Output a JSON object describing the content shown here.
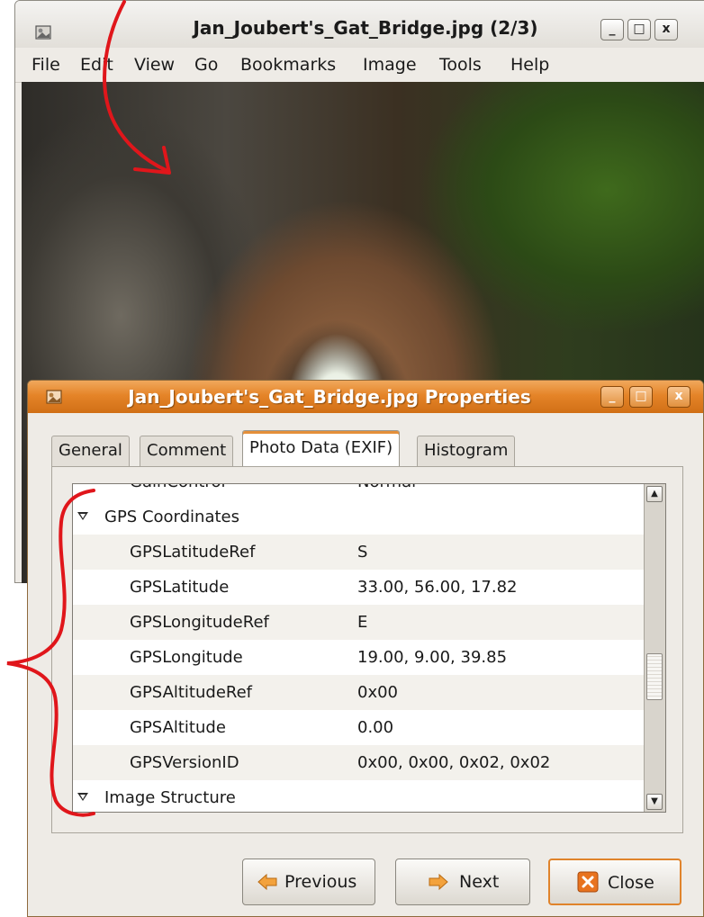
{
  "viewer": {
    "title": "Jan_Joubert's_Gat_Bridge.jpg  (2/3)",
    "window_buttons": {
      "minimize": "_",
      "maximize": "□",
      "close": "x"
    },
    "menu": [
      "File",
      "Edit",
      "View",
      "Go",
      "Bookmarks",
      "Image",
      "Tools",
      "Help"
    ]
  },
  "dialog": {
    "title": "Jan_Joubert's_Gat_Bridge.jpg Properties",
    "window_buttons": {
      "minimize": "_",
      "maximize": "□",
      "close": "x"
    },
    "tabs": [
      {
        "label": "General",
        "active": false
      },
      {
        "label": "Comment",
        "active": false
      },
      {
        "label": "Photo Data (EXIF)",
        "active": true
      },
      {
        "label": "Histogram",
        "active": false
      }
    ],
    "exif": {
      "partial_row": {
        "key": "GainControl",
        "value": "Normal"
      },
      "gps_group": "GPS Coordinates",
      "rows": [
        {
          "key": "GPSLatitudeRef",
          "value": "S"
        },
        {
          "key": "GPSLatitude",
          "value": "33.00, 56.00, 17.82"
        },
        {
          "key": "GPSLongitudeRef",
          "value": "E"
        },
        {
          "key": "GPSLongitude",
          "value": "19.00, 9.00, 39.85"
        },
        {
          "key": "GPSAltitudeRef",
          "value": "0x00"
        },
        {
          "key": "GPSAltitude",
          "value": "0.00"
        },
        {
          "key": "GPSVersionID",
          "value": "0x00, 0x00, 0x02, 0x02"
        }
      ],
      "next_group": "Image Structure"
    },
    "scrollbar": {
      "up": "▲",
      "down": "▼"
    },
    "buttons": {
      "previous": "Previous",
      "next": "Next",
      "close": "Close"
    }
  },
  "colors": {
    "dialog_titlebar": "#e58428",
    "focus_ring": "#e0832b",
    "annotation": "#e0161b"
  }
}
